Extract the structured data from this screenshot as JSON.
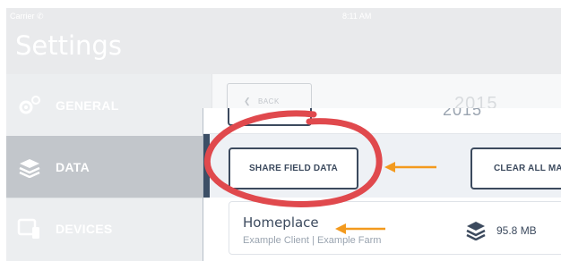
{
  "status_bar": {
    "carrier": "Carrier ✆",
    "time": "8:11 AM"
  },
  "header": {
    "title": "Settings"
  },
  "sidebar": {
    "items": [
      {
        "label": "GENERAL",
        "icon": "gears-icon",
        "selected": false
      },
      {
        "label": "DATA",
        "icon": "layers-icon",
        "selected": true
      },
      {
        "label": "DEVICES",
        "icon": "devices-icon",
        "selected": false
      }
    ]
  },
  "main": {
    "back_label": "BACK",
    "year": "2015"
  },
  "zoom": {
    "year": "2015",
    "share_label": "SHARE FIELD DATA",
    "clear_label": "CLEAR ALL MAI",
    "field": {
      "name": "Homeplace",
      "subtitle": "Example Client | Example Farm",
      "size": "95.8 MB",
      "size_icon": "layers-icon"
    }
  },
  "annotations": {
    "circle_color": "#e0494d",
    "arrow_color": "#f39a1e"
  }
}
